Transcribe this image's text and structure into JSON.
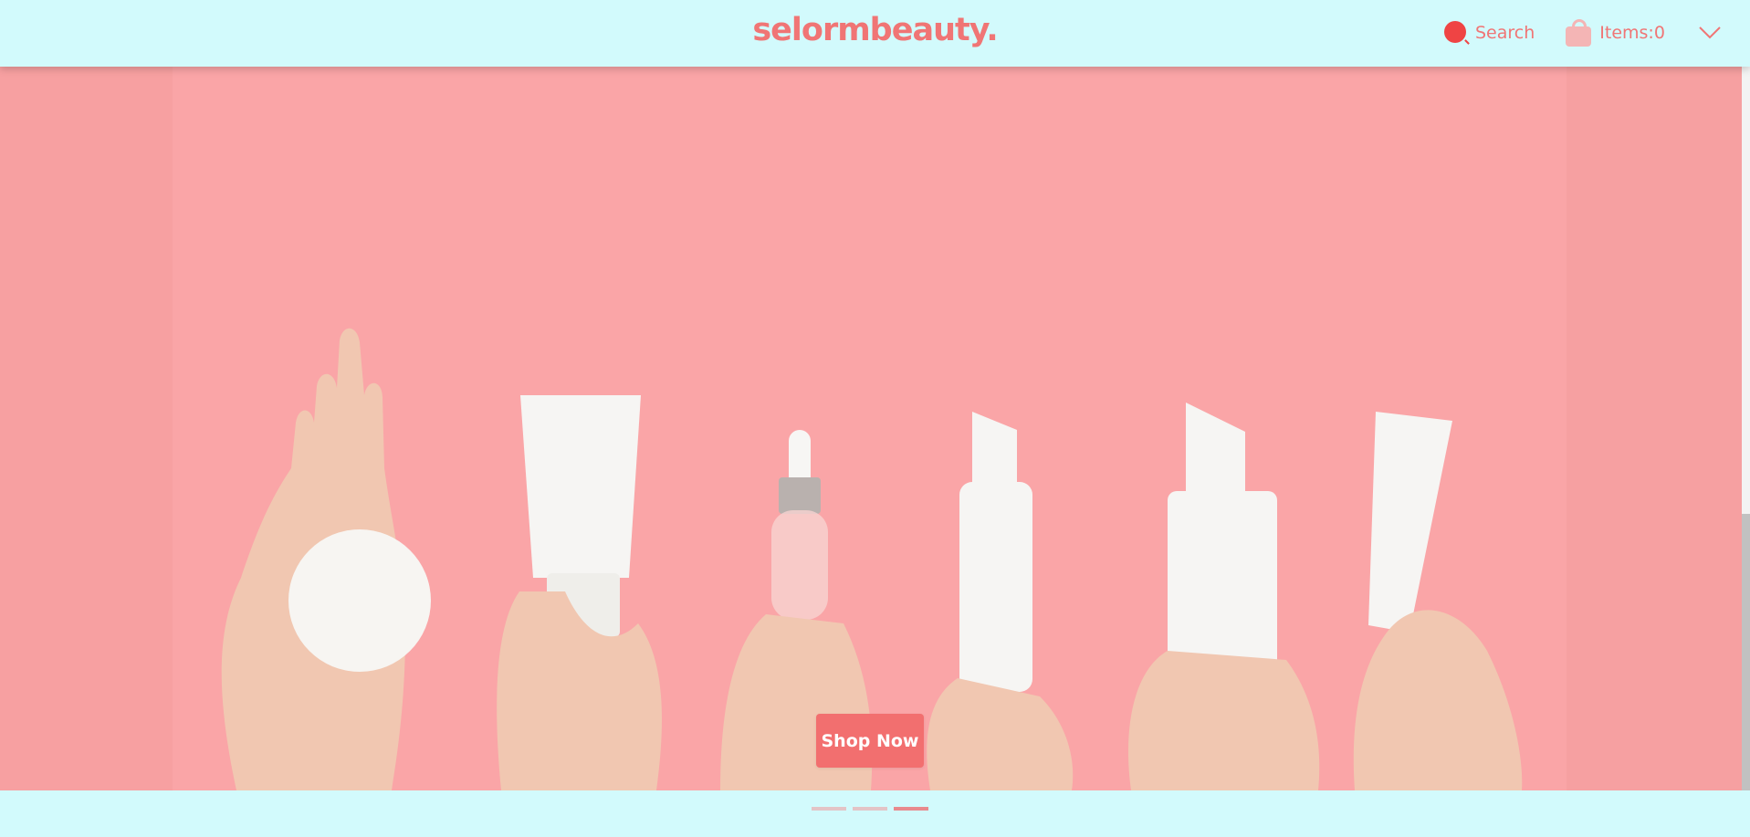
{
  "header": {
    "logo_text": "selormbeauty.",
    "search_label": "Search",
    "cart_label": "Items:0"
  },
  "hero": {
    "cta_label": "Shop Now"
  },
  "slider": {
    "active_index": 2,
    "dot_count": 3
  },
  "colors": {
    "header_bg": "#d2fafc",
    "brand": "#f07575",
    "hero_bg": "#f7a0a1",
    "cta_bg": "#f26f6f",
    "search_icon": "#ef4444",
    "bag_icon": "#f4b5b5"
  },
  "icons": [
    "search-icon",
    "shopping-bag-icon",
    "chevron-down-icon"
  ]
}
